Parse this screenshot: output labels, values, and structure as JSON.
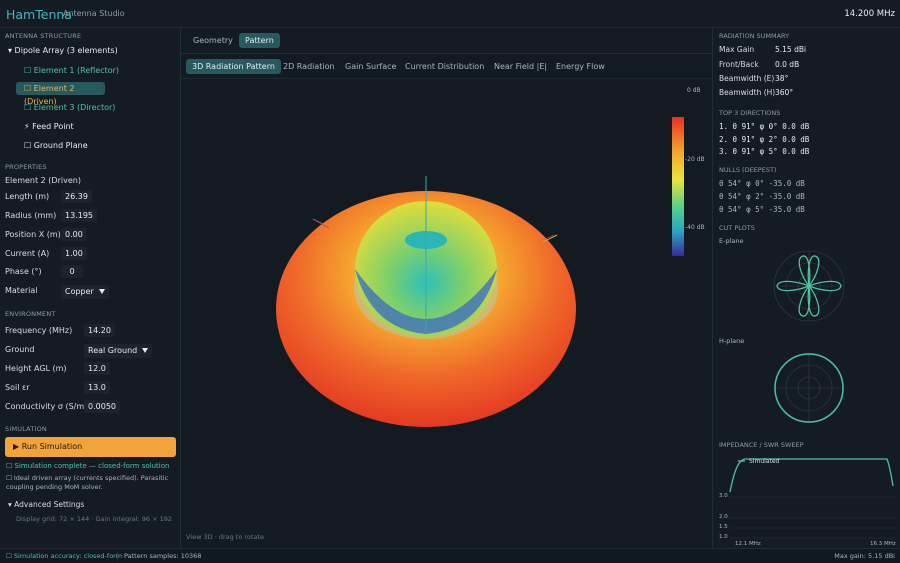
{
  "app": {
    "brand": "HamTenna",
    "subtitle": "Antenna Studio",
    "frequency_display": "14.200 MHz"
  },
  "left": {
    "structure_title": "ANTENNA STRUCTURE",
    "root_label": "▾ Dipole Array (3 elements)",
    "items": [
      {
        "label": "☐ Element 1 (Reflector)"
      },
      {
        "label": "☐ Element 2 (Driven)"
      },
      {
        "label": "☐ Element 3 (Director)"
      },
      {
        "label": "⚡ Feed Point"
      },
      {
        "label": "☐ Ground Plane"
      }
    ],
    "properties_title": "PROPERTIES",
    "selected_name": "Element 2 (Driven)",
    "properties": [
      {
        "label": "Length (m)",
        "value": "26.39"
      },
      {
        "label": "Radius (mm)",
        "value": "13.195"
      },
      {
        "label": "Position X (m)",
        "value": "0.00"
      },
      {
        "label": "Current (A)",
        "value": "1.00"
      },
      {
        "label": "Phase (°)",
        "value": "0"
      }
    ],
    "material": {
      "label": "Material",
      "value": "Copper"
    },
    "environment_title": "ENVIRONMENT",
    "frequency": {
      "label": "Frequency (MHz)",
      "value": "14.20"
    },
    "ground": {
      "label": "Ground",
      "value": "Real Ground"
    },
    "height": {
      "label": "Height AGL (m)",
      "value": "12.0"
    },
    "soil": {
      "label": "Soil εr",
      "value": "13.0"
    },
    "conductivity": {
      "label": "Conductivity σ (S/m)",
      "value": "0.0050"
    },
    "simulation_title": "SIMULATION",
    "run_label": "▶  Run Simulation",
    "status": "☐ Simulation complete — closed-form solution",
    "note": "☐ Ideal driven array (currents specified). Parasitic coupling pending MoM solver.",
    "advanced": "▾  Advanced Settings",
    "grid_info": "Display grid: 72 × 144 · Gain integral: 96 × 192"
  },
  "center": {
    "top_tabs": [
      "Geometry",
      "Pattern"
    ],
    "sub_tabs": [
      "3D Radiation Pattern",
      "2D Radiation",
      "Gain Surface",
      "Current Distribution",
      "Near Field |E|",
      "Energy Flow"
    ],
    "colorbar": {
      "top": "0 dB",
      "mid": "-20 dB",
      "bottom": "-40 dB"
    },
    "hint": "View 3D · drag to rotate"
  },
  "right": {
    "summary_title": "RADIATION SUMMARY",
    "summary": [
      {
        "label": "Max Gain",
        "value": "5.15 dBi"
      },
      {
        "label": "Front/Back",
        "value": "0.0 dB"
      },
      {
        "label": "Beamwidth (E)",
        "value": "38°"
      },
      {
        "label": "Beamwidth (H)",
        "value": "360°"
      }
    ],
    "top_title": "TOP 3 DIRECTIONS",
    "top": [
      "1. θ 91° φ 0°   0.0 dB",
      "2. θ 91° φ 2°   0.0 dB",
      "3. θ 91° φ 5°   0.0 dB"
    ],
    "nulls_title": "NULLS (DEEPEST)",
    "nulls": [
      "θ 54° φ 0°  -35.0 dB",
      "θ 54° φ 2°  -35.0 dB",
      "θ 54° φ 5°  -35.0 dB"
    ],
    "cut_title": "CUT PLOTS",
    "eplane": "E-plane",
    "hplane": "H-plane",
    "swr_title": "IMPEDANCE / SWR SWEEP",
    "swr": {
      "legend": "Simulated",
      "y_ticks": [
        "3.0",
        "2.0",
        "1.5",
        "1.0"
      ],
      "x_ticks": [
        "12.1 MHz",
        "16.3 MHz"
      ]
    }
  },
  "statusbar": {
    "accuracy": "☐ Simulation accuracy: closed-form",
    "samples": "Pattern samples: 10368",
    "max_gain": "Max gain: 5.15 dBi"
  },
  "colors": {
    "accent": "#3fb8bd",
    "run_button": "#f2a33a",
    "selected_bg": "#265a5f",
    "element_text": "#4cc3a4"
  }
}
